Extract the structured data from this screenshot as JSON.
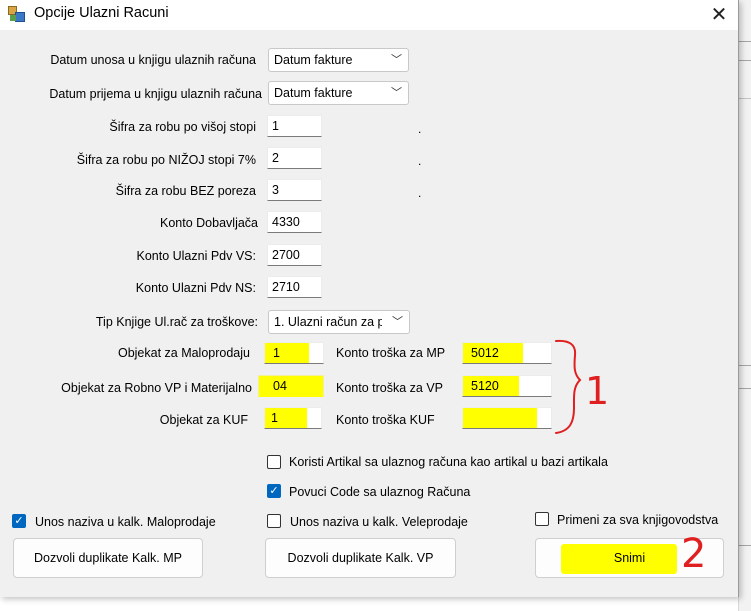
{
  "window": {
    "title": "Opcije Ulazni Racuni",
    "close_icon": "close-icon"
  },
  "fields": {
    "datum_unosa": {
      "label": "Datum unosa u knjigu ulaznih računa",
      "value": "Datum fakture"
    },
    "datum_prijema": {
      "label": "Datum prijema u knjigu ulaznih računa",
      "value": "Datum fakture"
    },
    "sifra_visa": {
      "label": "Šifra za robu po višoj stopi",
      "value": "1"
    },
    "sifra_niza": {
      "label": "Šifra za robu po NIŽOJ stopi 7%",
      "value": "2"
    },
    "sifra_bez": {
      "label": "Šifra za robu BEZ poreza",
      "value": "3"
    },
    "konto_dobavljaca": {
      "label": "Konto Dobavljača",
      "value": "4330"
    },
    "konto_pdv_vs": {
      "label": "Konto Ulazni Pdv VS:",
      "value": "2700"
    },
    "konto_pdv_ns": {
      "label": "Konto Ulazni Pdv NS:",
      "value": "2710"
    },
    "tip_knjige": {
      "label": "Tip Knjige Ul.rač za troškove:",
      "value": "1. Ulazni račun za p"
    },
    "objekat_mp": {
      "label": "Objekat za Maloprodaju",
      "value": "1"
    },
    "objekat_vp": {
      "label": "Objekat za Robno VP i Materijalno",
      "value": "04"
    },
    "objekat_kuf": {
      "label": "Objekat za KUF",
      "value": "1"
    },
    "konto_mp": {
      "label": "Konto troška za MP",
      "value": "5012"
    },
    "konto_vp": {
      "label": "Konto troška za VP",
      "value": "5120"
    },
    "konto_kuf": {
      "label": "Konto troška KUF",
      "value": ""
    }
  },
  "checkboxes": {
    "koristi_artikal": {
      "label": "Koristi Artikal sa ulaznog računa kao artikal u bazi artikala",
      "checked": false
    },
    "povuci_code": {
      "label": "Povuci Code sa ulaznog Računa",
      "checked": true
    },
    "unos_mp": {
      "label": "Unos naziva u kalk. Maloprodaje",
      "checked": true
    },
    "unos_vp": {
      "label": "Unos naziva u kalk. Veleprodaje",
      "checked": false
    },
    "primeni_sva": {
      "label": "Primeni za sva knjigovodstva",
      "checked": false
    }
  },
  "buttons": {
    "dozvoli_mp": "Dozvoli duplikate Kalk. MP",
    "dozvoli_vp": "Dozvoli duplikate Kalk. VP",
    "snimi": "Snimi"
  },
  "annotations": {
    "bracket_number": "1",
    "save_number": "2",
    "color": "#e02020"
  },
  "colors": {
    "highlight": "#ffff00",
    "checkbox_checked": "#0067c0",
    "dialog_bg": "#f0f0f0"
  }
}
